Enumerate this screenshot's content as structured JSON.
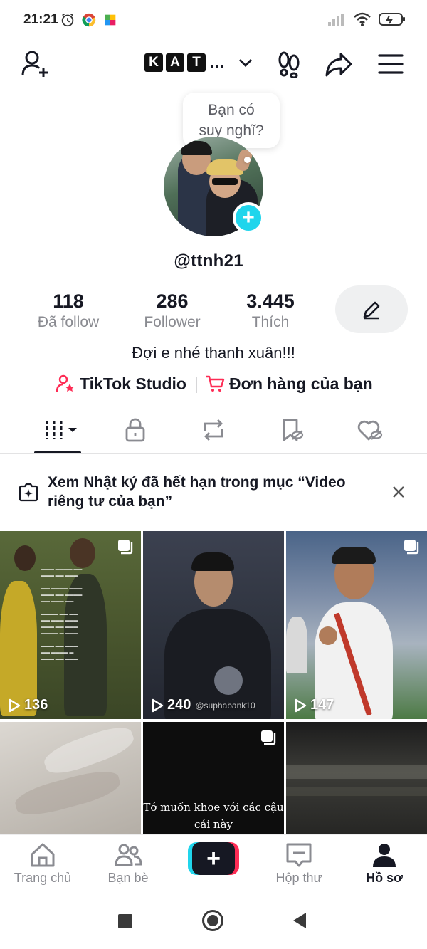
{
  "status_bar": {
    "time": "21:21",
    "icons": [
      "alarm-icon",
      "chrome-icon",
      "puzzle-app-icon",
      "signal-icon",
      "wifi-icon",
      "battery-icon"
    ]
  },
  "header": {
    "account_letters": [
      "K",
      "A",
      "T"
    ],
    "account_ellipsis": "...",
    "icons": [
      "add-user-icon",
      "chevron-down-icon",
      "footprints-icon",
      "share-icon",
      "menu-icon"
    ]
  },
  "thought_bubble": {
    "line1": "Bạn có",
    "line2": "suy nghĩ?"
  },
  "profile": {
    "username": "@ttnh21_",
    "stats": [
      {
        "value": "118",
        "label": "Đã follow"
      },
      {
        "value": "286",
        "label": "Follower"
      },
      {
        "value": "3.445",
        "label": "Thích"
      }
    ],
    "bio": "Đợi e nhé thanh xuân!!!",
    "links": [
      {
        "label": "TikTok Studio",
        "icon": "studio-person-star-icon"
      },
      {
        "label": "Đơn hàng của bạn",
        "icon": "cart-icon"
      }
    ]
  },
  "tabs": [
    {
      "icon": "videos-grid-icon",
      "active": true
    },
    {
      "icon": "lock-icon",
      "active": false
    },
    {
      "icon": "repost-icon",
      "active": false
    },
    {
      "icon": "bookmark-hidden-icon",
      "active": false
    },
    {
      "icon": "liked-hidden-icon",
      "active": false
    }
  ],
  "notice": {
    "line1": "Xem Nhật ký đã hết hạn trong mục “Video",
    "line2": "riêng tư của bạn”"
  },
  "videos": [
    {
      "views": "136",
      "multi": true
    },
    {
      "views": "240",
      "watermark": "@suphabank10",
      "multi": false
    },
    {
      "views": "147",
      "multi": true
    },
    {
      "views": ""
    },
    {
      "caption_line1": "Tớ muốn khoe với các cậu",
      "caption_line2": "cái này",
      "multi": true
    },
    {
      "views": ""
    }
  ],
  "bottom_nav": [
    {
      "label": "Trang chủ",
      "icon": "home-icon"
    },
    {
      "label": "Bạn bè",
      "icon": "friends-icon"
    },
    {
      "label": "",
      "icon": "create-plus-icon"
    },
    {
      "label": "Hộp thư",
      "icon": "inbox-icon"
    },
    {
      "label": "Hồ sơ",
      "icon": "profile-icon",
      "active": true
    }
  ],
  "colors": {
    "accent_cyan": "#20d5ec",
    "accent_red": "#fe2c55",
    "text_primary": "#161823",
    "text_secondary": "#8a8b91"
  }
}
